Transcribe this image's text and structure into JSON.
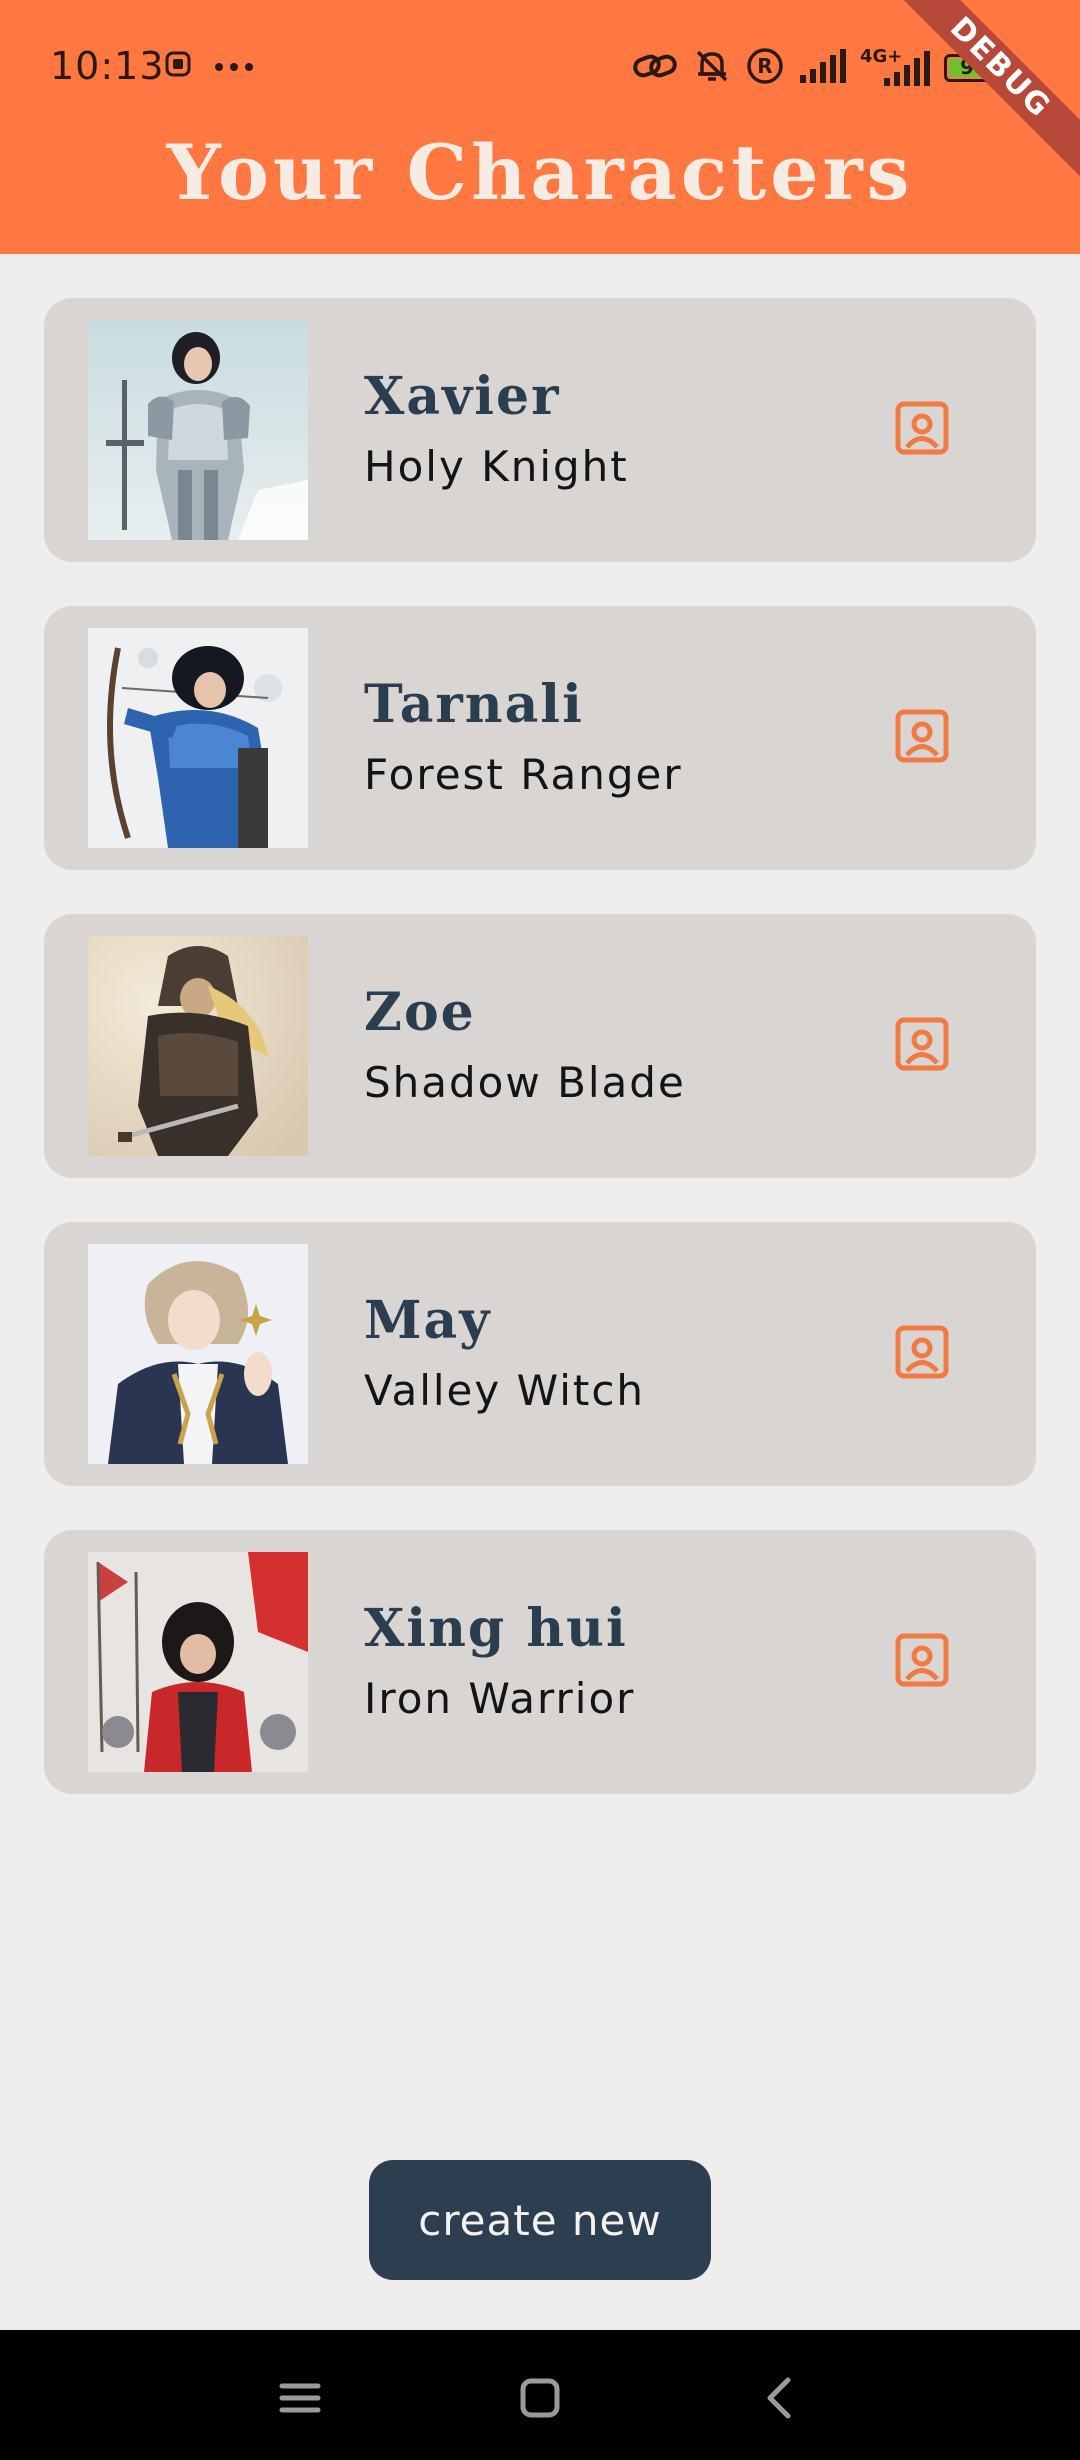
{
  "status_bar": {
    "time": "10:13",
    "battery_level": "94",
    "network": "4G+",
    "debug_label": "DEBUG"
  },
  "header": {
    "title": "Your Characters"
  },
  "characters": [
    {
      "name": "Xavier",
      "class": "Holy Knight"
    },
    {
      "name": "Tarnali",
      "class": "Forest Ranger"
    },
    {
      "name": "Zoe",
      "class": "Shadow Blade"
    },
    {
      "name": "May",
      "class": "Valley Witch"
    },
    {
      "name": "Xing hui",
      "class": "Iron Warrior"
    }
  ],
  "actions": {
    "create_label": "create new"
  },
  "colors": {
    "header_bg": "#ff7842",
    "accent": "#f07a44",
    "card_bg": "#d9d5d3",
    "name_text": "#2b3e50",
    "button_bg": "#2c3e50",
    "page_bg": "#f0eeec"
  },
  "icons": {
    "profile": "portrait-icon",
    "nav_menu": "menu-icon",
    "nav_home": "home-icon",
    "nav_back": "back-icon"
  }
}
